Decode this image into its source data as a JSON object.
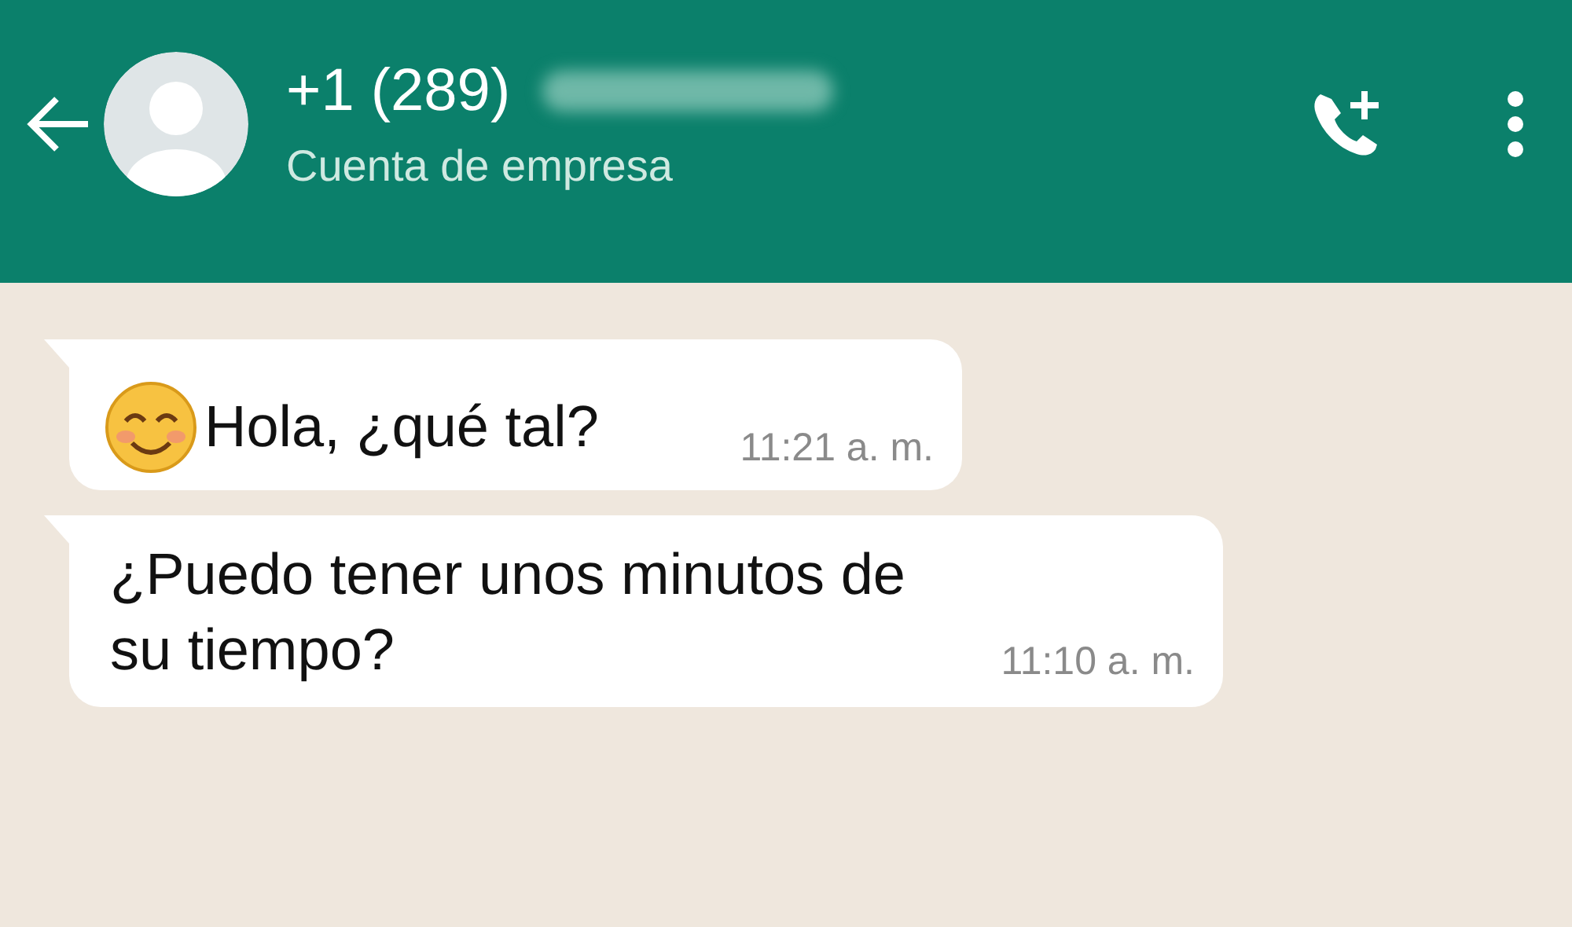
{
  "contact": {
    "name": "+1 (289)",
    "subtitle": "Cuenta de empresa",
    "number_hidden": true
  },
  "messages": [
    {
      "kind": "emoji",
      "text": "Hola, ¿qué tal?",
      "time": "11:21 a. m."
    },
    {
      "kind": "text",
      "text": "¿Puedo tener unos minutos de su tiempo?",
      "time": "11:10 a. m."
    }
  ]
}
